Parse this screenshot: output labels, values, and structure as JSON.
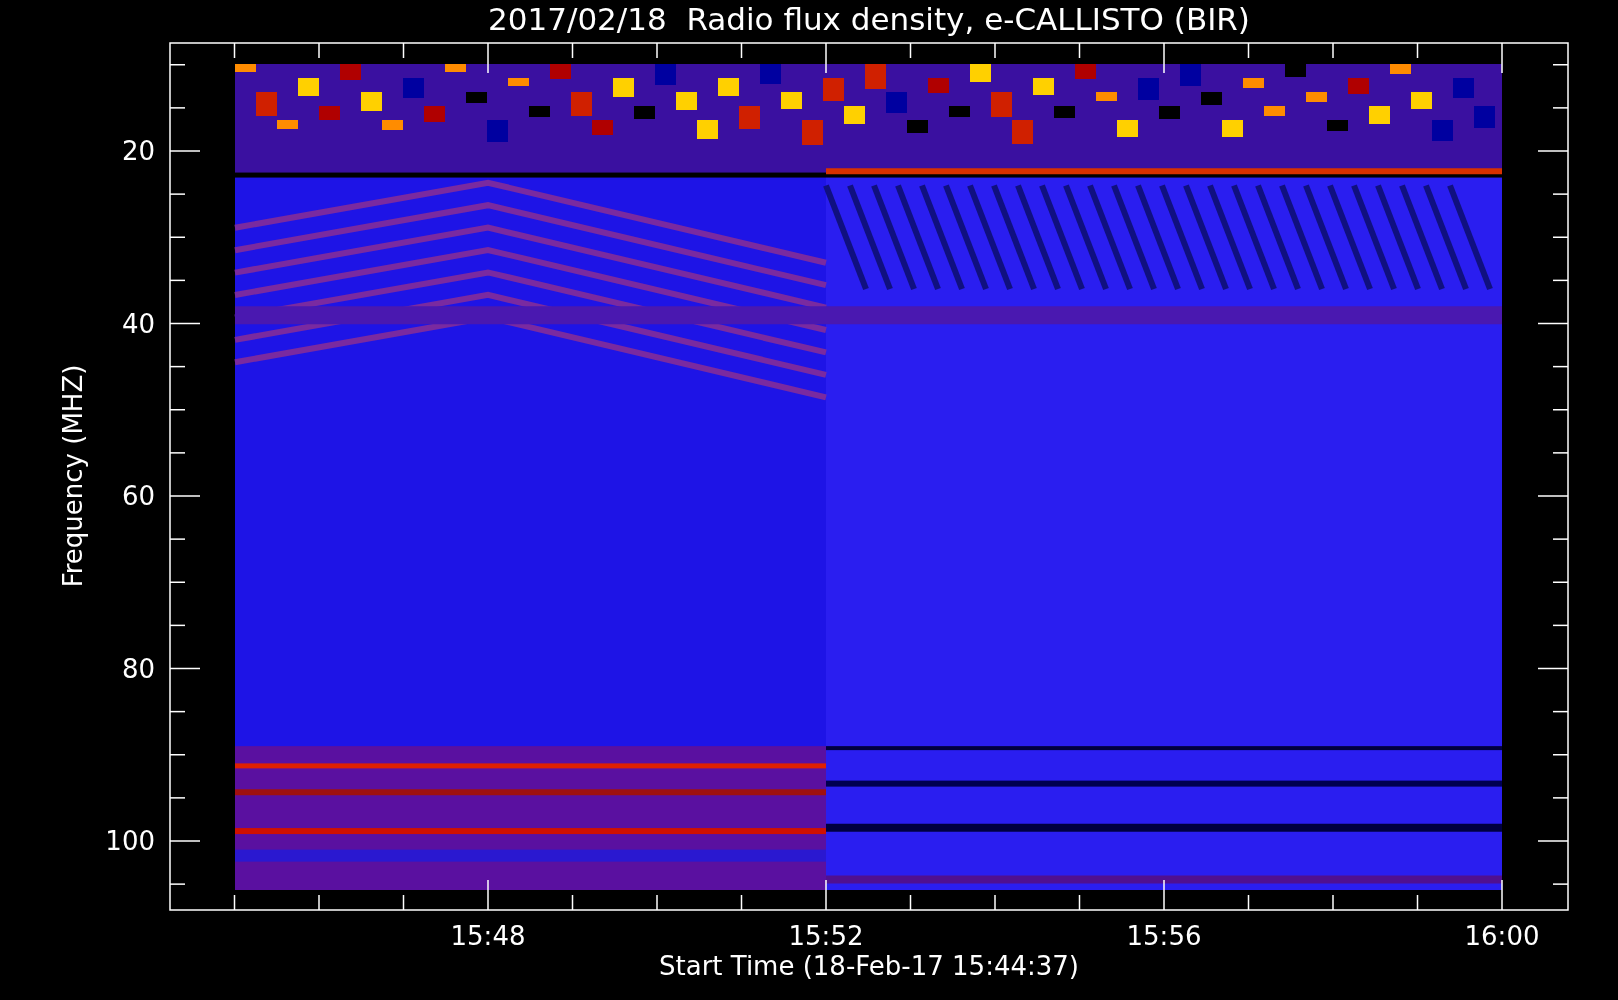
{
  "plot": {
    "title": "2017/02/18  Radio flux density, e-CALLISTO (BIR)",
    "ylabel": "Frequency (MHZ)",
    "xlabel": "Start Time (18-Feb-17 15:44:37)",
    "yticks": [
      "20",
      "40",
      "60",
      "80",
      "100"
    ],
    "xticks": [
      "15:48",
      "15:52",
      "15:56",
      "16:00"
    ]
  }
}
